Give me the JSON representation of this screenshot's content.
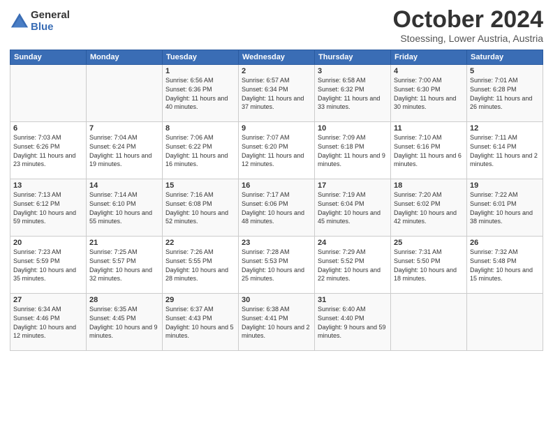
{
  "logo": {
    "general": "General",
    "blue": "Blue"
  },
  "header": {
    "month": "October 2024",
    "location": "Stoessing, Lower Austria, Austria"
  },
  "weekdays": [
    "Sunday",
    "Monday",
    "Tuesday",
    "Wednesday",
    "Thursday",
    "Friday",
    "Saturday"
  ],
  "weeks": [
    [
      {
        "day": "",
        "sunrise": "",
        "sunset": "",
        "daylight": ""
      },
      {
        "day": "",
        "sunrise": "",
        "sunset": "",
        "daylight": ""
      },
      {
        "day": "1",
        "sunrise": "Sunrise: 6:56 AM",
        "sunset": "Sunset: 6:36 PM",
        "daylight": "Daylight: 11 hours and 40 minutes."
      },
      {
        "day": "2",
        "sunrise": "Sunrise: 6:57 AM",
        "sunset": "Sunset: 6:34 PM",
        "daylight": "Daylight: 11 hours and 37 minutes."
      },
      {
        "day": "3",
        "sunrise": "Sunrise: 6:58 AM",
        "sunset": "Sunset: 6:32 PM",
        "daylight": "Daylight: 11 hours and 33 minutes."
      },
      {
        "day": "4",
        "sunrise": "Sunrise: 7:00 AM",
        "sunset": "Sunset: 6:30 PM",
        "daylight": "Daylight: 11 hours and 30 minutes."
      },
      {
        "day": "5",
        "sunrise": "Sunrise: 7:01 AM",
        "sunset": "Sunset: 6:28 PM",
        "daylight": "Daylight: 11 hours and 26 minutes."
      }
    ],
    [
      {
        "day": "6",
        "sunrise": "Sunrise: 7:03 AM",
        "sunset": "Sunset: 6:26 PM",
        "daylight": "Daylight: 11 hours and 23 minutes."
      },
      {
        "day": "7",
        "sunrise": "Sunrise: 7:04 AM",
        "sunset": "Sunset: 6:24 PM",
        "daylight": "Daylight: 11 hours and 19 minutes."
      },
      {
        "day": "8",
        "sunrise": "Sunrise: 7:06 AM",
        "sunset": "Sunset: 6:22 PM",
        "daylight": "Daylight: 11 hours and 16 minutes."
      },
      {
        "day": "9",
        "sunrise": "Sunrise: 7:07 AM",
        "sunset": "Sunset: 6:20 PM",
        "daylight": "Daylight: 11 hours and 12 minutes."
      },
      {
        "day": "10",
        "sunrise": "Sunrise: 7:09 AM",
        "sunset": "Sunset: 6:18 PM",
        "daylight": "Daylight: 11 hours and 9 minutes."
      },
      {
        "day": "11",
        "sunrise": "Sunrise: 7:10 AM",
        "sunset": "Sunset: 6:16 PM",
        "daylight": "Daylight: 11 hours and 6 minutes."
      },
      {
        "day": "12",
        "sunrise": "Sunrise: 7:11 AM",
        "sunset": "Sunset: 6:14 PM",
        "daylight": "Daylight: 11 hours and 2 minutes."
      }
    ],
    [
      {
        "day": "13",
        "sunrise": "Sunrise: 7:13 AM",
        "sunset": "Sunset: 6:12 PM",
        "daylight": "Daylight: 10 hours and 59 minutes."
      },
      {
        "day": "14",
        "sunrise": "Sunrise: 7:14 AM",
        "sunset": "Sunset: 6:10 PM",
        "daylight": "Daylight: 10 hours and 55 minutes."
      },
      {
        "day": "15",
        "sunrise": "Sunrise: 7:16 AM",
        "sunset": "Sunset: 6:08 PM",
        "daylight": "Daylight: 10 hours and 52 minutes."
      },
      {
        "day": "16",
        "sunrise": "Sunrise: 7:17 AM",
        "sunset": "Sunset: 6:06 PM",
        "daylight": "Daylight: 10 hours and 48 minutes."
      },
      {
        "day": "17",
        "sunrise": "Sunrise: 7:19 AM",
        "sunset": "Sunset: 6:04 PM",
        "daylight": "Daylight: 10 hours and 45 minutes."
      },
      {
        "day": "18",
        "sunrise": "Sunrise: 7:20 AM",
        "sunset": "Sunset: 6:02 PM",
        "daylight": "Daylight: 10 hours and 42 minutes."
      },
      {
        "day": "19",
        "sunrise": "Sunrise: 7:22 AM",
        "sunset": "Sunset: 6:01 PM",
        "daylight": "Daylight: 10 hours and 38 minutes."
      }
    ],
    [
      {
        "day": "20",
        "sunrise": "Sunrise: 7:23 AM",
        "sunset": "Sunset: 5:59 PM",
        "daylight": "Daylight: 10 hours and 35 minutes."
      },
      {
        "day": "21",
        "sunrise": "Sunrise: 7:25 AM",
        "sunset": "Sunset: 5:57 PM",
        "daylight": "Daylight: 10 hours and 32 minutes."
      },
      {
        "day": "22",
        "sunrise": "Sunrise: 7:26 AM",
        "sunset": "Sunset: 5:55 PM",
        "daylight": "Daylight: 10 hours and 28 minutes."
      },
      {
        "day": "23",
        "sunrise": "Sunrise: 7:28 AM",
        "sunset": "Sunset: 5:53 PM",
        "daylight": "Daylight: 10 hours and 25 minutes."
      },
      {
        "day": "24",
        "sunrise": "Sunrise: 7:29 AM",
        "sunset": "Sunset: 5:52 PM",
        "daylight": "Daylight: 10 hours and 22 minutes."
      },
      {
        "day": "25",
        "sunrise": "Sunrise: 7:31 AM",
        "sunset": "Sunset: 5:50 PM",
        "daylight": "Daylight: 10 hours and 18 minutes."
      },
      {
        "day": "26",
        "sunrise": "Sunrise: 7:32 AM",
        "sunset": "Sunset: 5:48 PM",
        "daylight": "Daylight: 10 hours and 15 minutes."
      }
    ],
    [
      {
        "day": "27",
        "sunrise": "Sunrise: 6:34 AM",
        "sunset": "Sunset: 4:46 PM",
        "daylight": "Daylight: 10 hours and 12 minutes."
      },
      {
        "day": "28",
        "sunrise": "Sunrise: 6:35 AM",
        "sunset": "Sunset: 4:45 PM",
        "daylight": "Daylight: 10 hours and 9 minutes."
      },
      {
        "day": "29",
        "sunrise": "Sunrise: 6:37 AM",
        "sunset": "Sunset: 4:43 PM",
        "daylight": "Daylight: 10 hours and 5 minutes."
      },
      {
        "day": "30",
        "sunrise": "Sunrise: 6:38 AM",
        "sunset": "Sunset: 4:41 PM",
        "daylight": "Daylight: 10 hours and 2 minutes."
      },
      {
        "day": "31",
        "sunrise": "Sunrise: 6:40 AM",
        "sunset": "Sunset: 4:40 PM",
        "daylight": "Daylight: 9 hours and 59 minutes."
      },
      {
        "day": "",
        "sunrise": "",
        "sunset": "",
        "daylight": ""
      },
      {
        "day": "",
        "sunrise": "",
        "sunset": "",
        "daylight": ""
      }
    ]
  ]
}
